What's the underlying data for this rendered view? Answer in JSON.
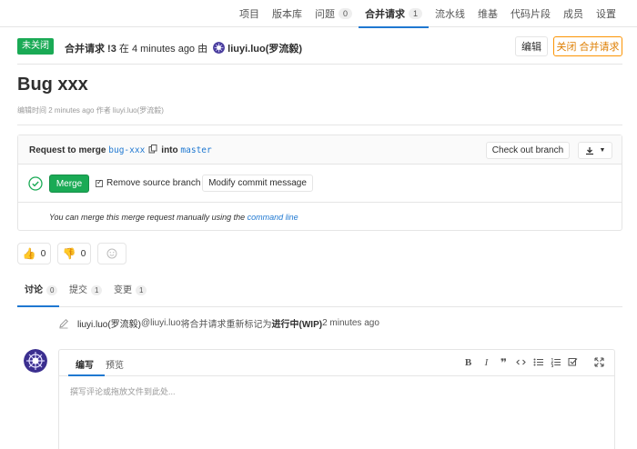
{
  "nav": {
    "items": [
      {
        "label": "项目",
        "count": null
      },
      {
        "label": "版本库",
        "count": null
      },
      {
        "label": "问题",
        "count": "0"
      },
      {
        "label": "合并请求",
        "count": "1"
      },
      {
        "label": "流水线",
        "count": null
      },
      {
        "label": "维基",
        "count": null
      },
      {
        "label": "代码片段",
        "count": null
      },
      {
        "label": "成员",
        "count": null
      },
      {
        "label": "设置",
        "count": null
      }
    ],
    "active": "合并请求"
  },
  "header": {
    "status": "未关闭",
    "mr_ref": "合并请求 !3",
    "time_text": " 在 4 minutes ago 由 ",
    "author": "liuyi.luo(罗流毅)",
    "edit_label": "编辑",
    "close_label": "关闭 合并请求"
  },
  "title": "Bug xxx",
  "edited_note": "编辑时间 2 minutes ago 作者 liuyi.luo(罗流毅)",
  "widget": {
    "request_to_merge": "Request to merge",
    "source_branch": "bug-xxx",
    "into": "into",
    "target_branch": "master",
    "checkout_label": "Check out branch",
    "merge_label": "Merge",
    "remove_source_label": "Remove source branch",
    "remove_source_checked": true,
    "modify_commit_label": "Modify commit message",
    "manual_text": "You can merge this merge request manually using the ",
    "manual_link": "command line"
  },
  "awards": {
    "thumbs_up": "0",
    "thumbs_down": "0"
  },
  "tabs": [
    {
      "label": "讨论",
      "count": "0"
    },
    {
      "label": "提交",
      "count": "1"
    },
    {
      "label": "变更",
      "count": "1"
    }
  ],
  "activity": {
    "author": "liuyi.luo(罗流毅)",
    "handle": " @liuyi.luo ",
    "action": "将合并请求重新标记为 ",
    "status": "进行中(WIP)",
    "time": " 2 minutes ago"
  },
  "editor": {
    "tab_write": "编写",
    "tab_preview": "预览",
    "placeholder": "撰写评论或拖放文件到此处...",
    "toolbar": [
      "bold-icon",
      "italic-icon",
      "quote-icon",
      "code-icon",
      "bullet-list-icon",
      "numbered-list-icon",
      "task-list-icon",
      "fullscreen-icon"
    ]
  },
  "colors": {
    "accent": "#1f78d1",
    "success": "#1aaa55",
    "warning": "#fc9403",
    "border": "#e5e5e5"
  }
}
